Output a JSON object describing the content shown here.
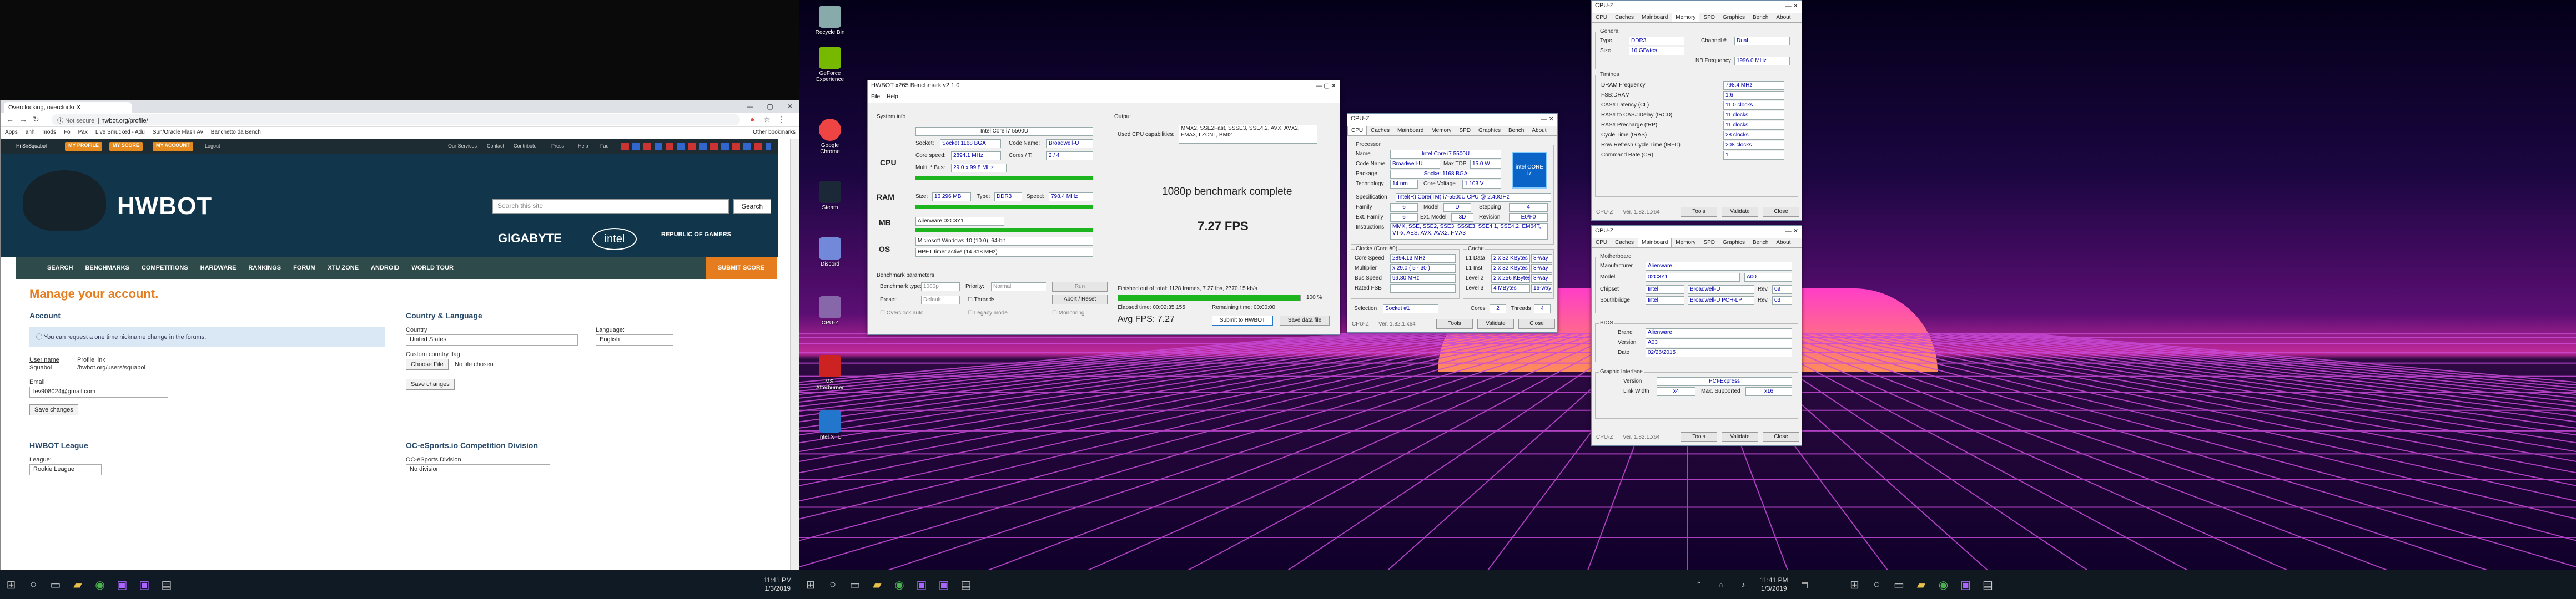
{
  "browser": {
    "tab_title": "Overclocking, overclocki",
    "url_security": "Not secure",
    "url": "hwbot.org/profile/",
    "bookmarks": [
      "Apps",
      "ahh",
      "mods",
      "Fo",
      "Pax",
      "Live Smucked - Adu",
      "Sun/Oracle Flash Av",
      "Banchetto da Bench",
      "Other bookmarks"
    ]
  },
  "hwbot": {
    "greeting": "Hi SirSquabol",
    "top_buttons": [
      "MY PROFILE",
      "MY SCORE",
      "MY ACCOUNT"
    ],
    "logout": "Logout",
    "top_links": [
      "Our Services",
      "Contact",
      "Contribute",
      "Press",
      "Help",
      "Faq"
    ],
    "logo": "HWBOT",
    "search_placeholder": "Search this site",
    "search_button": "Search",
    "sponsors": [
      "GIGABYTE",
      "intel",
      "REPUBLIC OF GAMERS"
    ],
    "nav": [
      "SEARCH",
      "BENCHMARKS",
      "COMPETITIONS",
      "HARDWARE",
      "RANKINGS",
      "FORUM",
      "XTU ZONE",
      "ANDROID",
      "WORLD TOUR"
    ],
    "submit_score": "SUBMIT SCORE",
    "page_title": "Manage your account.",
    "account_heading": "Account",
    "info_msg": "You can request a one time nickname change in the forums.",
    "username_label": "User name",
    "username_value": "Squabol",
    "profile_link_label": "Profile link",
    "profile_link_value": "/hwbot.org/users/squabol",
    "email_label": "Email",
    "email_value": "lev908024@gmail.com",
    "save_changes": "Save changes",
    "country_heading": "Country & Language",
    "country_label": "Country",
    "country_value": "United States",
    "language_label": "Language:",
    "language_value": "English",
    "flag_label": "Custom country flag:",
    "choose_file": "Choose File",
    "no_file": "No file chosen",
    "save_changes2": "Save changes",
    "league_heading": "HWBOT League",
    "league_label": "League:",
    "league_value": "Rookie League",
    "oc_heading": "OC-eSports.io Competition Division",
    "oc_label": "OC-eSports Division",
    "oc_value": "No division"
  },
  "desktop_icons": [
    "Recycle Bin",
    "GeForce Experience",
    "Google Chrome",
    "Steam",
    "Discord",
    "CPU-Z",
    "MSI Afterburner",
    "Intel XTU"
  ],
  "hwbench": {
    "title": "HWBOT x265 Benchmark v2.1.0",
    "menu": [
      "File",
      "Help"
    ],
    "system_info": "System info",
    "cpu_label": "CPU",
    "cpu_name": "Intel Core i7 5500U",
    "socket_label": "Socket:",
    "socket_value": "Socket 1168 BGA",
    "codename_label": "Code Name:",
    "codename_value": "Broadwell-U",
    "corespeed_label": "Core speed:",
    "corespeed_value": "2894.1 MHz",
    "corest_label": "Cores / T:",
    "corest_value": "2 / 4",
    "multi_label": "Multi. * Bus:",
    "multi_value": "29.0 x 99.8 MHz",
    "ram_label": "RAM",
    "size_label": "Size:",
    "size_value": "16 296 MB",
    "type_label": "Type:",
    "type_value": "DDR3",
    "speed_label": "Speed:",
    "speed_value": "798.4 MHz",
    "mb_label": "MB",
    "mb_value": "Alienware 02C3Y1",
    "os_label": "OS",
    "os_value": "Microsoft Windows 10 (10.0), 64-bit",
    "timer_value": "HPET timer active (14.318 MHz)",
    "output_label": "Output",
    "caps_label": "Used CPU capabilities:",
    "caps_value": "MMX2, SSE2Fast, SSSE3, SSE4.2, AVX, AVX2, FMA3, LZCNT, BMI2",
    "complete": "1080p benchmark complete",
    "fps": "7.27 FPS",
    "params_label": "Benchmark parameters",
    "bench_type_label": "Benchmark type:",
    "bench_type_value": "1080p",
    "priority_label": "Priority:",
    "priority_value": "Normal",
    "preset_label": "Preset:",
    "preset_value": "Default",
    "threads_label": "Threads",
    "abort": "Abort / Reset",
    "overclock": "Overclock auto",
    "legacy": "Legacy mode",
    "monitoring": "Monitoring",
    "finished": "Finished out of total: 1128 frames, 7.27 fps, 2770.15 kb/s",
    "progress_pct": "100 %",
    "progress": 1.0,
    "elapsed": "Elapsed time: 00:02:35.155",
    "remaining": "Remaining time: 00:00:00",
    "avg_fps": "Avg FPS: 7.27",
    "submit": "Submit to HWBOT",
    "save": "Save data file"
  },
  "cpuz_cpu": {
    "title": "CPU-Z",
    "tabs": [
      "CPU",
      "Caches",
      "Mainboard",
      "Memory",
      "SPD",
      "Graphics",
      "Bench",
      "About"
    ],
    "processor": "Processor",
    "name": "Intel Core i7 5500U",
    "codename": "Broadwell-U",
    "maxtdp": "15.0 W",
    "package": "Socket 1168 BGA",
    "technology": "14 nm",
    "corevoltage": "1.103 V",
    "spec": "Intel(R) Core(TM) i7-5500U CPU @ 2.40GHz",
    "family": "6",
    "model": "D",
    "stepping": "4",
    "extfamily": "6",
    "extmodel": "3D",
    "revision": "E0/F0",
    "instructions": "MMX, SSE, SSE2, SSE3, SSSE3, SSE4.1, SSE4.2, EM64T, VT-x, AES, AVX, AVX2, FMA3",
    "clocks": "Clocks (Core #0)",
    "corespeed": "2894.13 MHz",
    "multiplier": "x 29.0 ( 5 - 30 )",
    "busspeed": "99.80 MHz",
    "cache": "Cache",
    "l1d": "2 x 32 KBytes",
    "l1d_way": "8-way",
    "l1i": "2 x 32 KBytes",
    "l1i_way": "8-way",
    "l2": "2 x 256 KBytes",
    "l2_way": "8-way",
    "l3": "4 MBytes",
    "l3_way": "16-way",
    "selection": "Socket #1",
    "cores": "2",
    "threads": "4",
    "version": "Ver. 1.82.1.x64",
    "tools": "Tools",
    "validate": "Validate",
    "close": "Close",
    "intel_badge": "intel CORE i7"
  },
  "cpuz_mem": {
    "title": "CPU-Z",
    "tabs": [
      "CPU",
      "Caches",
      "Mainboard",
      "Memory",
      "SPD",
      "Graphics",
      "Bench",
      "About"
    ],
    "general": "General",
    "type": "DDR3",
    "channel": "Dual",
    "size": "16 GBytes",
    "nbfreq": "1996.0 MHz",
    "timings": "Timings",
    "rows": [
      [
        "DRAM Frequency",
        "798.4 MHz"
      ],
      [
        "FSB:DRAM",
        "1:6"
      ],
      [
        "CAS# Latency (CL)",
        "11.0 clocks"
      ],
      [
        "RAS# to CAS# Delay (tRCD)",
        "11 clocks"
      ],
      [
        "RAS# Precharge (tRP)",
        "11 clocks"
      ],
      [
        "Cycle Time (tRAS)",
        "28 clocks"
      ],
      [
        "Row Refresh Cycle Time (tRFC)",
        "208 clocks"
      ],
      [
        "Command Rate (CR)",
        "1T"
      ]
    ],
    "version": "Ver. 1.82.1.x64",
    "tools": "Tools",
    "validate": "Validate",
    "close": "Close"
  },
  "cpuz_mb": {
    "title": "CPU-Z",
    "tabs": [
      "CPU",
      "Caches",
      "Mainboard",
      "Memory",
      "SPD",
      "Graphics",
      "Bench",
      "About"
    ],
    "motherboard": "Motherboard",
    "manufacturer": "Alienware",
    "model": "02C3Y1",
    "model_rev": "A00",
    "chipset": "Intel",
    "chipset_name": "Broadwell-U",
    "chipset_rev": "09",
    "southbridge": "Intel",
    "south_name": "Broadwell-U PCH-LP",
    "south_rev": "03",
    "bios": "BIOS",
    "brand": "Alienware",
    "bios_version": "A03",
    "date": "02/26/2015",
    "graphic": "Graphic Interface",
    "gi_version": "PCI-Express",
    "linkwidth": "x4",
    "maxsupported": "x16",
    "version": "Ver. 1.82.1.x64",
    "tools": "Tools",
    "validate": "Validate",
    "close": "Close"
  },
  "taskbar": {
    "time1": "11:41 PM",
    "date1": "1/3/2019",
    "time2": "11:41 PM",
    "date2": "1/3/2019"
  }
}
